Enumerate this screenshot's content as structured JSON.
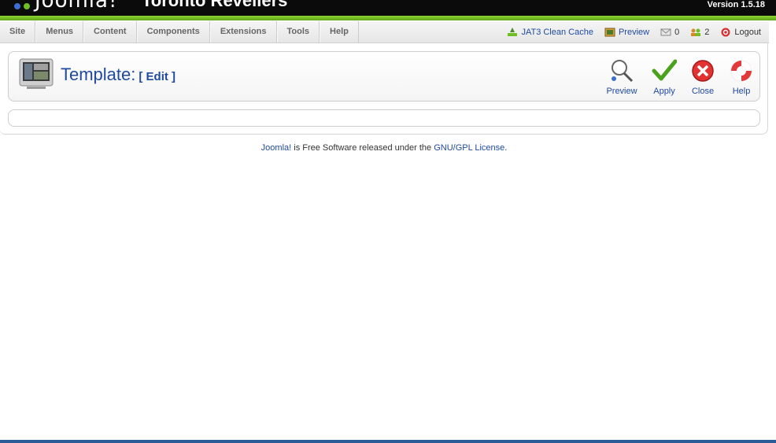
{
  "header": {
    "logo_text": "Joomla!",
    "site_name": "Toronto Revellers",
    "version": "Version 1.5.18"
  },
  "menu": {
    "items": [
      "Site",
      "Menus",
      "Content",
      "Components",
      "Extensions",
      "Tools",
      "Help"
    ]
  },
  "status": {
    "clean_cache": "JAT3 Clean Cache",
    "preview": "Preview",
    "messages_count": "0",
    "users_count": "2",
    "logout": "Logout"
  },
  "toolbar": {
    "title": "Template:",
    "subtitle": "[ Edit ]",
    "buttons": {
      "preview": "Preview",
      "apply": "Apply",
      "close": "Close",
      "help": "Help"
    }
  },
  "footer": {
    "joomla_link": "Joomla!",
    "text_middle": " is Free Software released under the ",
    "license_link": "GNU/GPL License",
    "text_end": "."
  },
  "colors": {
    "header": "#0b0b0b",
    "accent_green": "#6fbf24",
    "link_blue": "#1f4aa0",
    "bottom_bar": "#2b5c97"
  }
}
